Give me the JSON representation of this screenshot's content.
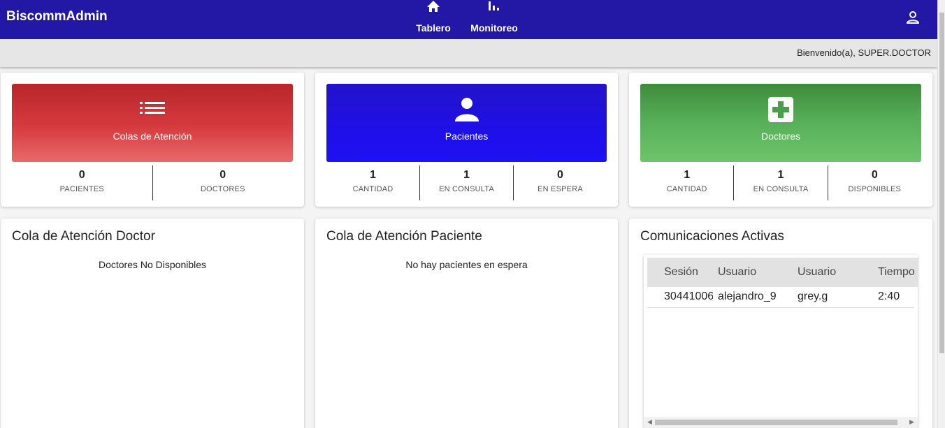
{
  "app": {
    "title": "BiscommAdmin"
  },
  "nav": {
    "items": [
      {
        "label": "Tablero",
        "icon": "home-icon"
      },
      {
        "label": "Monitoreo",
        "icon": "bar-chart-icon"
      }
    ],
    "user_icon": "account-icon"
  },
  "subheader": {
    "welcome": "Bienvenido(a), SUPER.DOCTOR"
  },
  "colors": {
    "primary": "#2318a6",
    "red": "#d63a3f",
    "blue": "#1f0fe8",
    "green": "#58b05a"
  },
  "stat_cards": [
    {
      "title": "Colas de Atención",
      "icon": "list-icon",
      "stats": [
        {
          "value": "0",
          "label": "PACIENTES"
        },
        {
          "value": "0",
          "label": "DOCTORES"
        }
      ]
    },
    {
      "title": "Pacientes",
      "icon": "person-icon",
      "stats": [
        {
          "value": "1",
          "label": "CANTIDAD"
        },
        {
          "value": "1",
          "label": "EN CONSULTA"
        },
        {
          "value": "0",
          "label": "EN ESPERA"
        }
      ]
    },
    {
      "title": "Doctores",
      "icon": "medical-cross-icon",
      "stats": [
        {
          "value": "1",
          "label": "CANTIDAD"
        },
        {
          "value": "1",
          "label": "EN CONSULTA"
        },
        {
          "value": "0",
          "label": "DISPONIBLES"
        }
      ]
    }
  ],
  "queues": {
    "doctor": {
      "title": "Cola de Atención Doctor",
      "empty": "Doctores No Disponibles"
    },
    "patient": {
      "title": "Cola de Atención Paciente",
      "empty": "No hay pacientes en espera"
    }
  },
  "communications": {
    "title": "Comunicaciones Activas",
    "columns": [
      "Sesión",
      "Usuario",
      "Usuario",
      "Tiempo"
    ],
    "rows": [
      [
        "30441006",
        "alejandro_9",
        "grey.g",
        "2:40"
      ]
    ]
  }
}
